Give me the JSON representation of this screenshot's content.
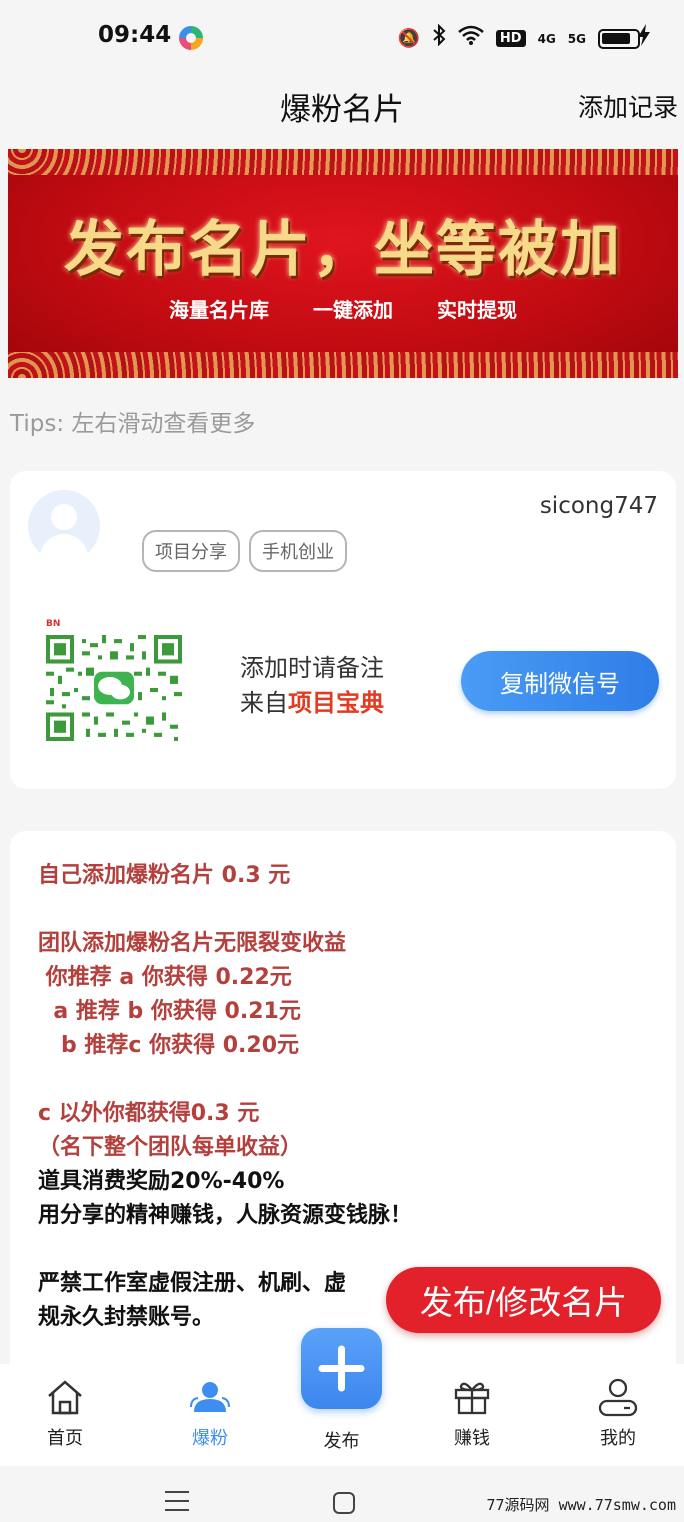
{
  "status_bar": {
    "time": "09:44",
    "icons": [
      "mute-icon",
      "bluetooth-icon",
      "wifi-icon",
      "hd-icon",
      "signal-4g-icon",
      "signal-5g-icon",
      "battery-icon",
      "charging-icon"
    ],
    "hd": "HD",
    "net1": "4G",
    "net2": "5G"
  },
  "header": {
    "title": "爆粉名片",
    "action": "添加记录"
  },
  "banner": {
    "headline": "发布名片，坐等被加",
    "features": [
      "海量名片库",
      "一键添加",
      "实时提现"
    ]
  },
  "tips": "Tips: 左右滑动查看更多",
  "card": {
    "username": "sicong747",
    "tags": [
      "项目分享",
      "手机创业"
    ],
    "note_line1": "添加时请备注",
    "note_prefix": "来自",
    "note_highlight": "项目宝典",
    "copy_button": "复制微信号"
  },
  "rules": [
    {
      "text": "自己添加爆粉名片 0.3 元",
      "style": "r"
    },
    {
      "text": "",
      "style": "gap"
    },
    {
      "text": "团队添加爆粉名片无限裂变收益",
      "style": "r"
    },
    {
      "text": " 你推荐 a 你获得 0.22元",
      "style": "r"
    },
    {
      "text": "  a 推荐 b 你获得 0.21元",
      "style": "r"
    },
    {
      "text": "   b 推荐c 你获得 0.20元",
      "style": "r"
    },
    {
      "text": "",
      "style": "gap"
    },
    {
      "text": "c 以外你都获得0.3 元",
      "style": "r"
    },
    {
      "text": "（名下整个团队每单收益）",
      "style": "r"
    },
    {
      "text": "道具消费奖励20%-40%",
      "style": "k"
    },
    {
      "text": "用分享的精神赚钱，人脉资源变钱脉！",
      "style": "k"
    },
    {
      "text": "",
      "style": "gap"
    },
    {
      "text": "严禁工作室虚假注册、机刷、虚",
      "style": "k"
    },
    {
      "text": "规永久封禁账号。",
      "style": "k"
    }
  ],
  "publish_button": "发布/修改名片",
  "nav": {
    "home": "首页",
    "fans": "爆粉",
    "publish": "发布",
    "earn": "赚钱",
    "mine": "我的"
  },
  "accent_color": "#3d8ef0",
  "watermark": "77源码网 www.77smw.com"
}
